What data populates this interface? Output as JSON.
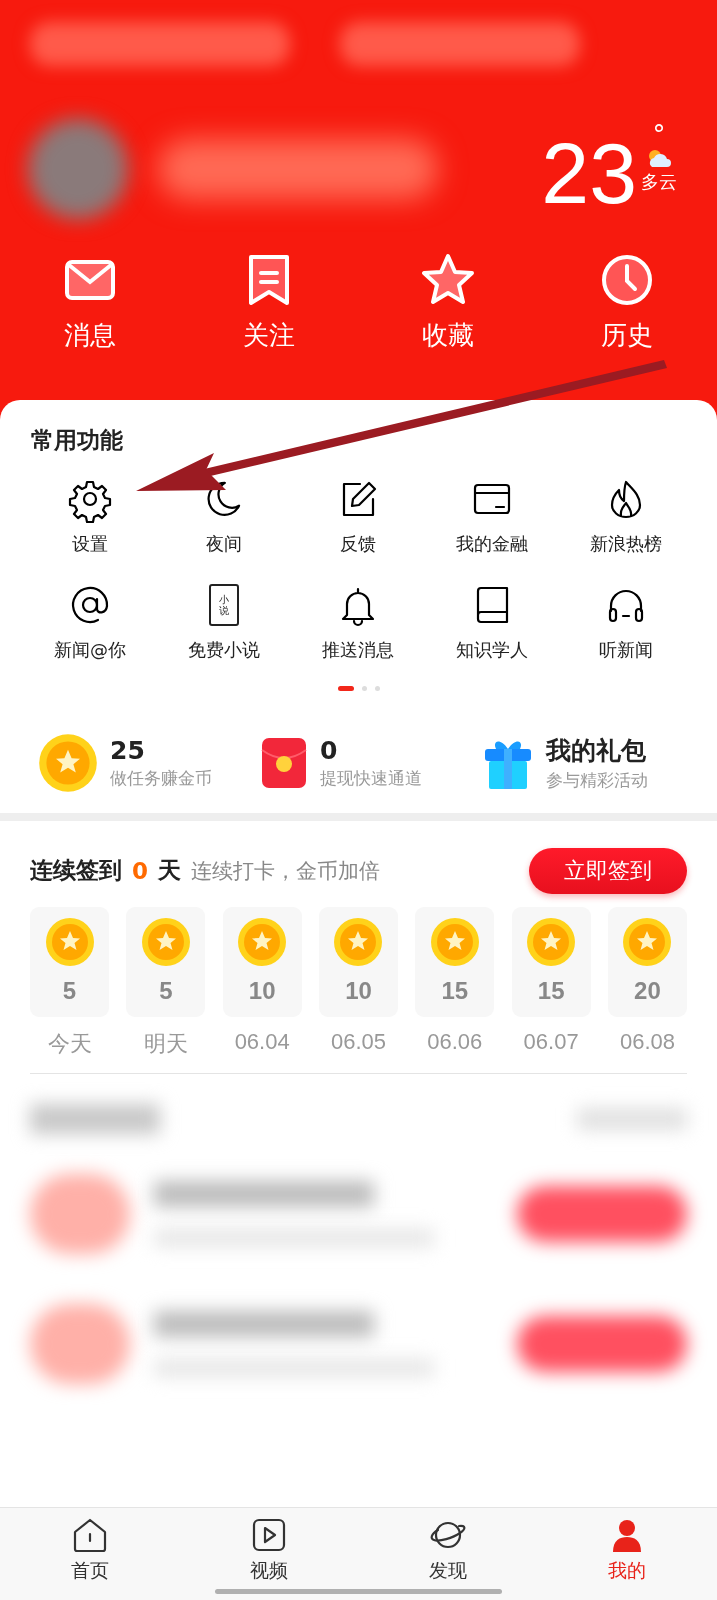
{
  "weather": {
    "temperature": "23",
    "degree": "°",
    "condition": "多云"
  },
  "quick_actions": [
    {
      "label": "消息",
      "kind": "mail"
    },
    {
      "label": "关注",
      "kind": "bookmark"
    },
    {
      "label": "收藏",
      "kind": "star"
    },
    {
      "label": "历史",
      "kind": "clock"
    }
  ],
  "common_functions": {
    "title": "常用功能",
    "items": [
      {
        "label": "设置",
        "kind": "gear"
      },
      {
        "label": "夜间",
        "kind": "moon"
      },
      {
        "label": "反馈",
        "kind": "edit"
      },
      {
        "label": "我的金融",
        "kind": "card"
      },
      {
        "label": "新浪热榜",
        "kind": "flame"
      },
      {
        "label": "新闻@你",
        "kind": "at"
      },
      {
        "label": "免费小说",
        "kind": "novel",
        "icon_text": "小说"
      },
      {
        "label": "推送消息",
        "kind": "bell"
      },
      {
        "label": "知识学人",
        "kind": "book"
      },
      {
        "label": "听新闻",
        "kind": "headphones"
      }
    ],
    "pager": [
      {
        "selected": true
      },
      {
        "selected": false
      },
      {
        "selected": false
      }
    ]
  },
  "rewards": [
    {
      "title": "25",
      "caption": "做任务赚金币",
      "kind": "coin"
    },
    {
      "title": "0",
      "caption": "提现快速通道",
      "kind": "red-packet"
    },
    {
      "title": "我的礼包",
      "caption": "参与精彩活动",
      "kind": "gift"
    }
  ],
  "checkin": {
    "label": "连续签到",
    "streak": "0",
    "unit": "天",
    "hint": "连续打卡，金币加倍",
    "button": "立即签到",
    "days": [
      {
        "coins": "5",
        "date": "今天"
      },
      {
        "coins": "5",
        "date": "明天"
      },
      {
        "coins": "10",
        "date": "06.04"
      },
      {
        "coins": "10",
        "date": "06.05"
      },
      {
        "coins": "15",
        "date": "06.06"
      },
      {
        "coins": "15",
        "date": "06.07"
      },
      {
        "coins": "20",
        "date": "06.08"
      }
    ]
  },
  "tab_bar": [
    {
      "label": "首页",
      "kind": "home",
      "selected": false
    },
    {
      "label": "视频",
      "kind": "video",
      "selected": false
    },
    {
      "label": "发现",
      "kind": "planet",
      "selected": false
    },
    {
      "label": "我的",
      "kind": "me",
      "selected": true
    }
  ]
}
